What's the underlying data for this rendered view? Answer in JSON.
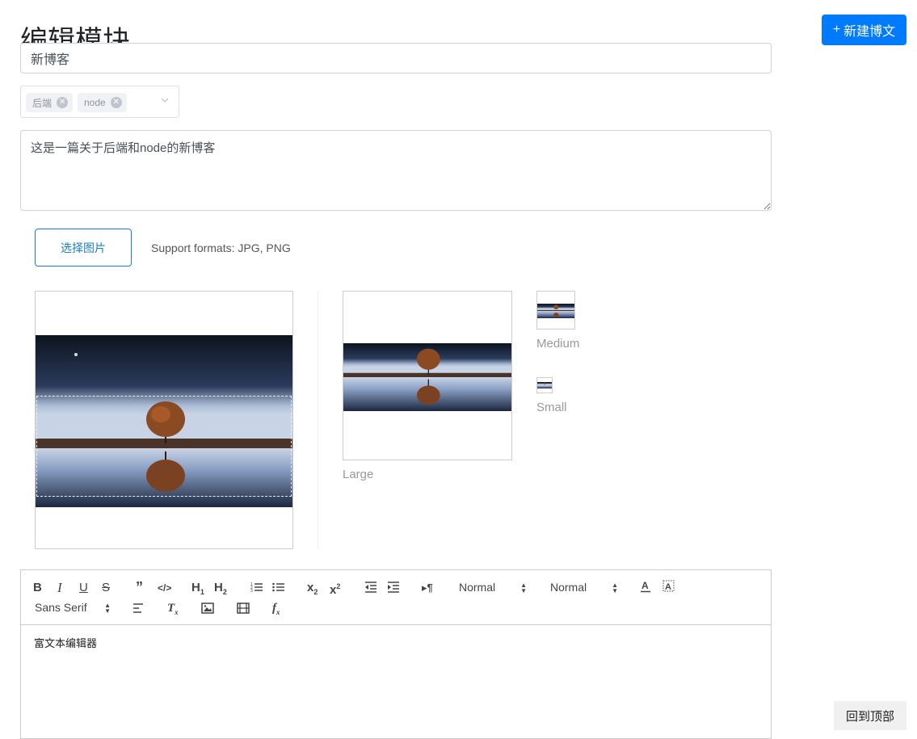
{
  "header": {
    "title": "编辑模块",
    "new_post_label": "新建博文",
    "new_post_icon": "+"
  },
  "form": {
    "title_value": "新博客",
    "tags": [
      {
        "label": "后端"
      },
      {
        "label": "node"
      }
    ],
    "description": "这是一篇关于后端和node的新博客"
  },
  "upload": {
    "button_label": "选择图片",
    "support_text": "Support formats: JPG, PNG"
  },
  "preview": {
    "large_label": "Large",
    "medium_label": "Medium",
    "small_label": "Small"
  },
  "editor": {
    "header_picker": "Normal",
    "size_picker": "Normal",
    "font_picker": "Sans Serif",
    "content": "富文本编辑器"
  },
  "back_to_top": "回到顶部",
  "colors": {
    "primary": "#007bff",
    "upload_border": "#1b7fc4"
  }
}
